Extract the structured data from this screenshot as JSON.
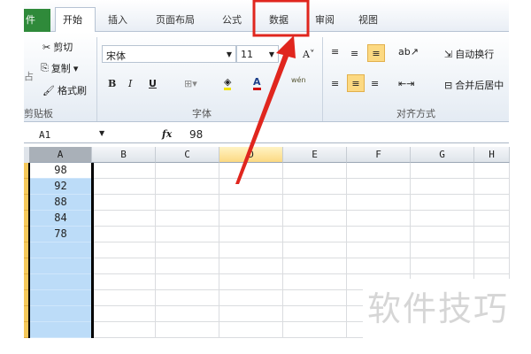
{
  "tabs": {
    "file": "件",
    "home": "开始",
    "insert": "插入",
    "page_layout": "页面布局",
    "formulas": "公式",
    "data": "数据",
    "review": "审阅",
    "view": "视图"
  },
  "clipboard": {
    "cut": "剪切",
    "copy": "复制",
    "format_painter": "格式刷",
    "paste": "占",
    "group": "剪贴板"
  },
  "font": {
    "name": "宋体",
    "size": "11",
    "bold": "B",
    "italic": "I",
    "underline": "U",
    "font_color_label": "A",
    "phonetic": "wén",
    "group": "字体"
  },
  "alignment": {
    "wrap_text": "自动换行",
    "merge_center": "合并后居中",
    "group": "对齐方式"
  },
  "formula_bar": {
    "name_box": "A1",
    "fx": "fx",
    "value": "98"
  },
  "columns": [
    "A",
    "B",
    "C",
    "D",
    "E",
    "F",
    "G",
    "H"
  ],
  "column_a_values": [
    "98",
    "92",
    "88",
    "84",
    "78",
    "",
    "",
    "",
    "",
    "",
    ""
  ],
  "watermark": "软件技巧",
  "colors": {
    "annotation": "#e0261e",
    "selection": "#bcdcf8",
    "highlight": "#fcd982",
    "file_tab": "#2f8a3a"
  }
}
